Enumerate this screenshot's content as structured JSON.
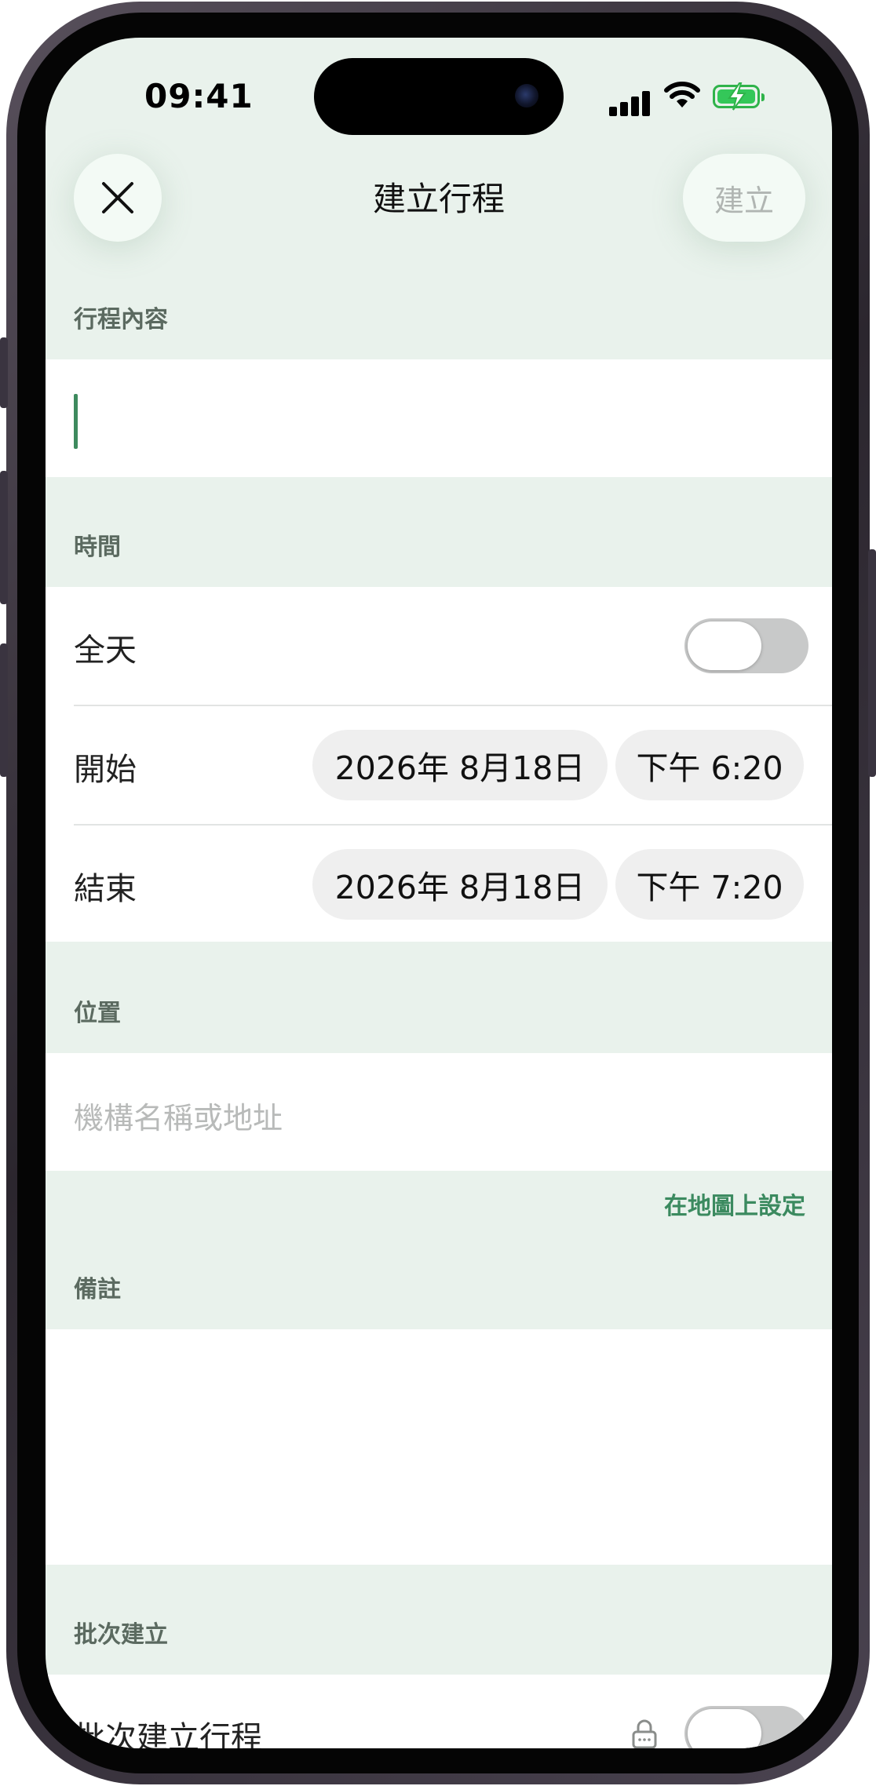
{
  "status_bar": {
    "time": "09:41"
  },
  "nav": {
    "title": "建立行程",
    "create_label": "建立"
  },
  "sections": {
    "content": {
      "header": "行程內容"
    },
    "time": {
      "header": "時間",
      "all_day_label": "全天",
      "all_day_on": false,
      "start": {
        "label": "開始",
        "date": "2026年 8月18日",
        "time": "下午 6:20"
      },
      "end": {
        "label": "結束",
        "date": "2026年 8月18日",
        "time": "下午 7:20"
      }
    },
    "location": {
      "header": "位置",
      "placeholder": "機構名稱或地址",
      "map_link": "在地圖上設定"
    },
    "notes": {
      "header": "備註"
    },
    "batch": {
      "header": "批次建立",
      "row_label": "批次建立行程"
    }
  },
  "colors": {
    "accent": "#3b8a5f",
    "section_bg": "#e9f2ec"
  }
}
